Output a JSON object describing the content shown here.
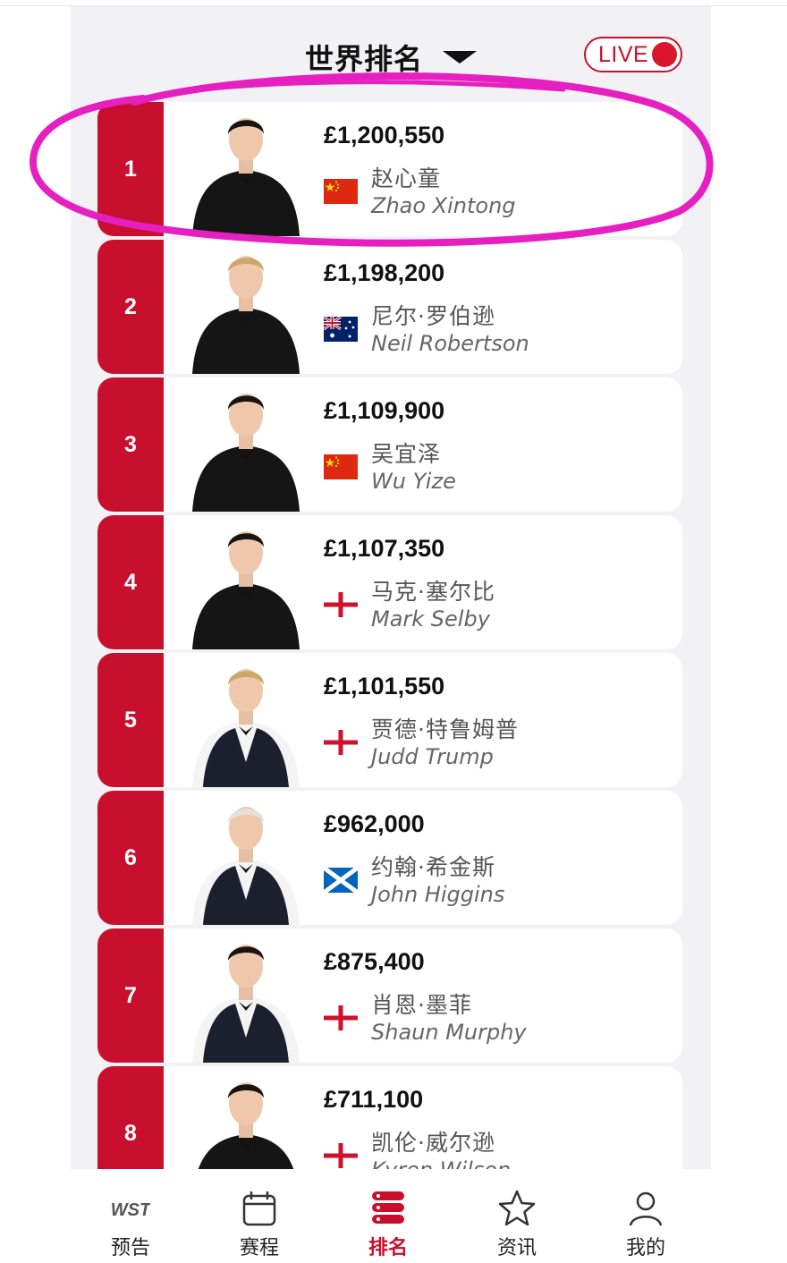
{
  "header": {
    "title": "世界排名",
    "live_label": "LIVE"
  },
  "colors": {
    "brand_red": "#c8102e",
    "highlight_magenta": "#e620c0",
    "panel_bg": "#f2f2f4"
  },
  "rankings": [
    {
      "rank": "1",
      "prize": "£1,200,550",
      "name_cn": "赵心童",
      "name_en": "Zhao Xintong",
      "flag": "china-flag"
    },
    {
      "rank": "2",
      "prize": "£1,198,200",
      "name_cn": "尼尔·罗伯逊",
      "name_en": "Neil Robertson",
      "flag": "australia-flag"
    },
    {
      "rank": "3",
      "prize": "£1,109,900",
      "name_cn": "吴宜泽",
      "name_en": "Wu Yize",
      "flag": "china-flag"
    },
    {
      "rank": "4",
      "prize": "£1,107,350",
      "name_cn": "马克·塞尔比",
      "name_en": "Mark Selby",
      "flag": "england-flag"
    },
    {
      "rank": "5",
      "prize": "£1,101,550",
      "name_cn": "贾德·特鲁姆普",
      "name_en": "Judd Trump",
      "flag": "england-flag"
    },
    {
      "rank": "6",
      "prize": "£962,000",
      "name_cn": "约翰·希金斯",
      "name_en": "John Higgins",
      "flag": "scotland-flag"
    },
    {
      "rank": "7",
      "prize": "£875,400",
      "name_cn": "肖恩·墨菲",
      "name_en": "Shaun Murphy",
      "flag": "england-flag"
    },
    {
      "rank": "8",
      "prize": "£711,100",
      "name_cn": "凯伦·威尔逊",
      "name_en": "Kyren Wilson",
      "flag": "england-flag"
    }
  ],
  "tabs": [
    {
      "label": "预告",
      "icon": "wst-logo-icon",
      "logo_text": "WST",
      "active": false
    },
    {
      "label": "赛程",
      "icon": "calendar-icon",
      "active": false
    },
    {
      "label": "排名",
      "icon": "rankings-stack-icon",
      "active": true
    },
    {
      "label": "资讯",
      "icon": "star-icon",
      "active": false
    },
    {
      "label": "我的",
      "icon": "user-icon",
      "active": false
    }
  ]
}
